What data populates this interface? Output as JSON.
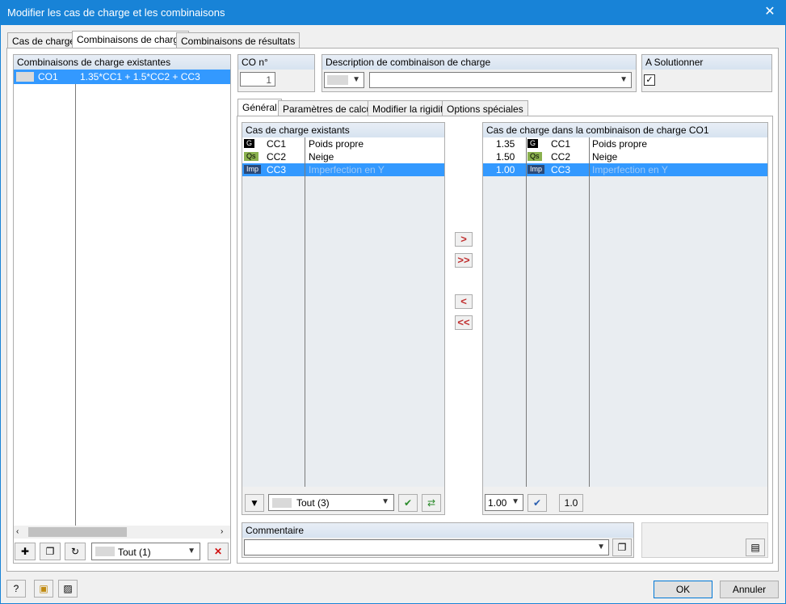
{
  "window": {
    "title": "Modifier les cas de charge et les combinaisons",
    "close_glyph": "✕"
  },
  "top_tabs": [
    "Cas de charge",
    "Combinaisons de charge",
    "Combinaisons de résultats"
  ],
  "existing_combos": {
    "header": "Combinaisons de charge existantes",
    "rows": [
      {
        "id": "CO1",
        "formula": "1.35*CC1 + 1.5*CC2 + CC3"
      }
    ],
    "filter_value": "Tout (1)"
  },
  "co_number": {
    "label": "CO n°",
    "value": "1"
  },
  "description": {
    "label": "Description de combinaison de charge",
    "value": ""
  },
  "solve": {
    "label": "A Solutionner",
    "checked": true
  },
  "inner_tabs": [
    "Général",
    "Paramètres de calcul",
    "Modifier la rigidité",
    "Options spéciales"
  ],
  "existing_cases": {
    "header": "Cas de charge existants",
    "rows": [
      {
        "tag": "G",
        "id": "CC1",
        "name": "Poids propre"
      },
      {
        "tag": "Qs",
        "id": "CC2",
        "name": "Neige"
      },
      {
        "tag": "Imp",
        "id": "CC3",
        "name": "Imperfection en Y"
      }
    ],
    "filter_value": "Tout (3)"
  },
  "arrows": {
    "add": ">",
    "add_all": ">>",
    "remove": "<",
    "remove_all": "<<"
  },
  "combo_cases": {
    "header": "Cas de charge dans la combinaison de charge CO1",
    "rows": [
      {
        "factor": "1.35",
        "tag": "G",
        "id": "CC1",
        "name": "Poids propre"
      },
      {
        "factor": "1.50",
        "tag": "Qs",
        "id": "CC2",
        "name": "Neige"
      },
      {
        "factor": "1.00",
        "tag": "Imp",
        "id": "CC3",
        "name": "Imperfection en Y"
      }
    ],
    "factor_value": "1.00",
    "reset_label": "1.0"
  },
  "comment": {
    "label": "Commentaire",
    "value": ""
  },
  "buttons": {
    "ok": "OK",
    "cancel": "Annuler"
  }
}
